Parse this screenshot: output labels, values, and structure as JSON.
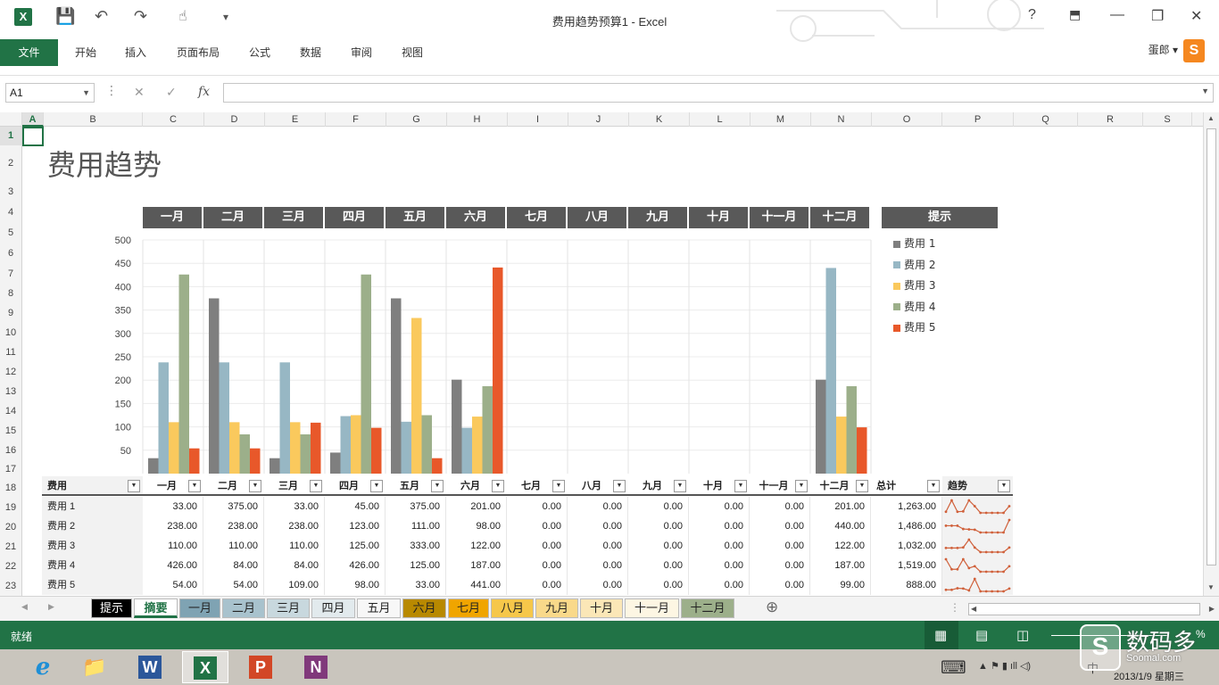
{
  "window": {
    "title": "费用趋势预算1 - Excel",
    "help": "?",
    "minimize": "—",
    "restore": "❐",
    "close": "✕"
  },
  "qat": {
    "excel_icon": "X",
    "save": "💾",
    "undo": "↶",
    "redo": "↷",
    "touch": "☝",
    "customize": "▾"
  },
  "ribbon": {
    "file": "文件",
    "tabs": [
      "开始",
      "插入",
      "页面布局",
      "公式",
      "数据",
      "审阅",
      "视图"
    ],
    "user": "蛋郎 ▾",
    "user_logo": "S"
  },
  "formula_bar": {
    "name_box": "A1",
    "cancel": "✕",
    "enter": "✓",
    "fx": "fx",
    "value": ""
  },
  "columns": [
    "A",
    "B",
    "C",
    "D",
    "E",
    "F",
    "G",
    "H",
    "I",
    "J",
    "K",
    "L",
    "M",
    "N",
    "O",
    "P",
    "Q",
    "R",
    "S"
  ],
  "rows": [
    "1",
    "2",
    "3",
    "4",
    "5",
    "6",
    "7",
    "8",
    "9",
    "10",
    "11",
    "12",
    "13",
    "14",
    "15",
    "16",
    "17",
    "18",
    "19",
    "20",
    "21",
    "22",
    "23"
  ],
  "sheet": {
    "title": "费用趋势",
    "months": [
      "一月",
      "二月",
      "三月",
      "四月",
      "五月",
      "六月",
      "七月",
      "八月",
      "九月",
      "十月",
      "十一月",
      "十二月"
    ],
    "hint_header": "提示",
    "legend": [
      "费用 1",
      "费用 2",
      "费用 3",
      "费用 4",
      "费用 5"
    ]
  },
  "chart_data": {
    "type": "bar",
    "categories": [
      "一月",
      "二月",
      "三月",
      "四月",
      "五月",
      "六月",
      "七月",
      "八月",
      "九月",
      "十月",
      "十一月",
      "十二月"
    ],
    "series": [
      {
        "name": "费用 1",
        "color": "#7f7f7f",
        "values": [
          33,
          375,
          33,
          45,
          375,
          201,
          0,
          0,
          0,
          0,
          0,
          201
        ]
      },
      {
        "name": "费用 2",
        "color": "#97b7c4",
        "values": [
          238,
          238,
          238,
          123,
          111,
          98,
          0,
          0,
          0,
          0,
          0,
          440
        ]
      },
      {
        "name": "费用 3",
        "color": "#fac95d",
        "values": [
          110,
          110,
          110,
          125,
          333,
          122,
          0,
          0,
          0,
          0,
          0,
          122
        ]
      },
      {
        "name": "费用 4",
        "color": "#9caf8a",
        "values": [
          426,
          84,
          84,
          426,
          125,
          187,
          0,
          0,
          0,
          0,
          0,
          187
        ]
      },
      {
        "name": "费用 5",
        "color": "#e8582a",
        "values": [
          54,
          54,
          109,
          98,
          33,
          441,
          0,
          0,
          0,
          0,
          0,
          99
        ]
      }
    ],
    "yticks": [
      "50",
      "100",
      "150",
      "200",
      "250",
      "300",
      "350",
      "400",
      "450",
      "500"
    ],
    "ylim": [
      0,
      500
    ],
    "grid": true,
    "legend": "right"
  },
  "table": {
    "headers": [
      "费用",
      "一月",
      "二月",
      "三月",
      "四月",
      "五月",
      "六月",
      "七月",
      "八月",
      "九月",
      "十月",
      "十一月",
      "十二月",
      "总计",
      "趋势"
    ],
    "rows": [
      {
        "name": "费用 1",
        "values": [
          "33.00",
          "375.00",
          "33.00",
          "45.00",
          "375.00",
          "201.00",
          "0.00",
          "0.00",
          "0.00",
          "0.00",
          "0.00",
          "201.00"
        ],
        "total": "1,263.00"
      },
      {
        "name": "费用 2",
        "values": [
          "238.00",
          "238.00",
          "238.00",
          "123.00",
          "111.00",
          "98.00",
          "0.00",
          "0.00",
          "0.00",
          "0.00",
          "0.00",
          "440.00"
        ],
        "total": "1,486.00"
      },
      {
        "name": "费用 3",
        "values": [
          "110.00",
          "110.00",
          "110.00",
          "125.00",
          "333.00",
          "122.00",
          "0.00",
          "0.00",
          "0.00",
          "0.00",
          "0.00",
          "122.00"
        ],
        "total": "1,032.00"
      },
      {
        "name": "费用 4",
        "values": [
          "426.00",
          "84.00",
          "84.00",
          "426.00",
          "125.00",
          "187.00",
          "0.00",
          "0.00",
          "0.00",
          "0.00",
          "0.00",
          "187.00"
        ],
        "total": "1,519.00"
      },
      {
        "name": "费用 5",
        "values": [
          "54.00",
          "54.00",
          "109.00",
          "98.00",
          "33.00",
          "441.00",
          "0.00",
          "0.00",
          "0.00",
          "0.00",
          "0.00",
          "99.00"
        ],
        "total": "888.00"
      }
    ],
    "sparkline_color": "#d0603a"
  },
  "sheet_tabs": [
    {
      "label": "提示",
      "bg": "#000000",
      "fg": "#ffffff"
    },
    {
      "label": "摘要",
      "bg": "#ffffff",
      "fg": "#217346"
    },
    {
      "label": "一月",
      "bg": "#7fa3b3",
      "fg": "#222222"
    },
    {
      "label": "二月",
      "bg": "#a8c2cd",
      "fg": "#222222"
    },
    {
      "label": "三月",
      "bg": "#c8d8de",
      "fg": "#222222"
    },
    {
      "label": "四月",
      "bg": "#e2eaed",
      "fg": "#222222"
    },
    {
      "label": "五月",
      "bg": "#f7f7f7",
      "fg": "#222222"
    },
    {
      "label": "六月",
      "bg": "#b88900",
      "fg": "#222222"
    },
    {
      "label": "七月",
      "bg": "#f0a500",
      "fg": "#222222"
    },
    {
      "label": "八月",
      "bg": "#f6c74a",
      "fg": "#222222"
    },
    {
      "label": "九月",
      "bg": "#f9d98a",
      "fg": "#222222"
    },
    {
      "label": "十月",
      "bg": "#fbe7b7",
      "fg": "#222222"
    },
    {
      "label": "十一月",
      "bg": "#fdf6e3",
      "fg": "#222222"
    },
    {
      "label": "十二月",
      "bg": "#9caf8a",
      "fg": "#222222"
    }
  ],
  "add_sheet": "⊕",
  "status": {
    "text": "就绪",
    "zoom": "%"
  },
  "taskbar": {
    "ie": "e",
    "explorer": "📁",
    "word": "W",
    "excel": "X",
    "ppt": "P",
    "onenote": "N",
    "keyboard": "⌨",
    "tray": "▲ ⚑ ▮ ıll ◁)",
    "ime": "中",
    "date": "2013/1/9 星期三"
  },
  "watermark": {
    "logo": "S",
    "title": "数码多",
    "site": "Soomal.com"
  }
}
